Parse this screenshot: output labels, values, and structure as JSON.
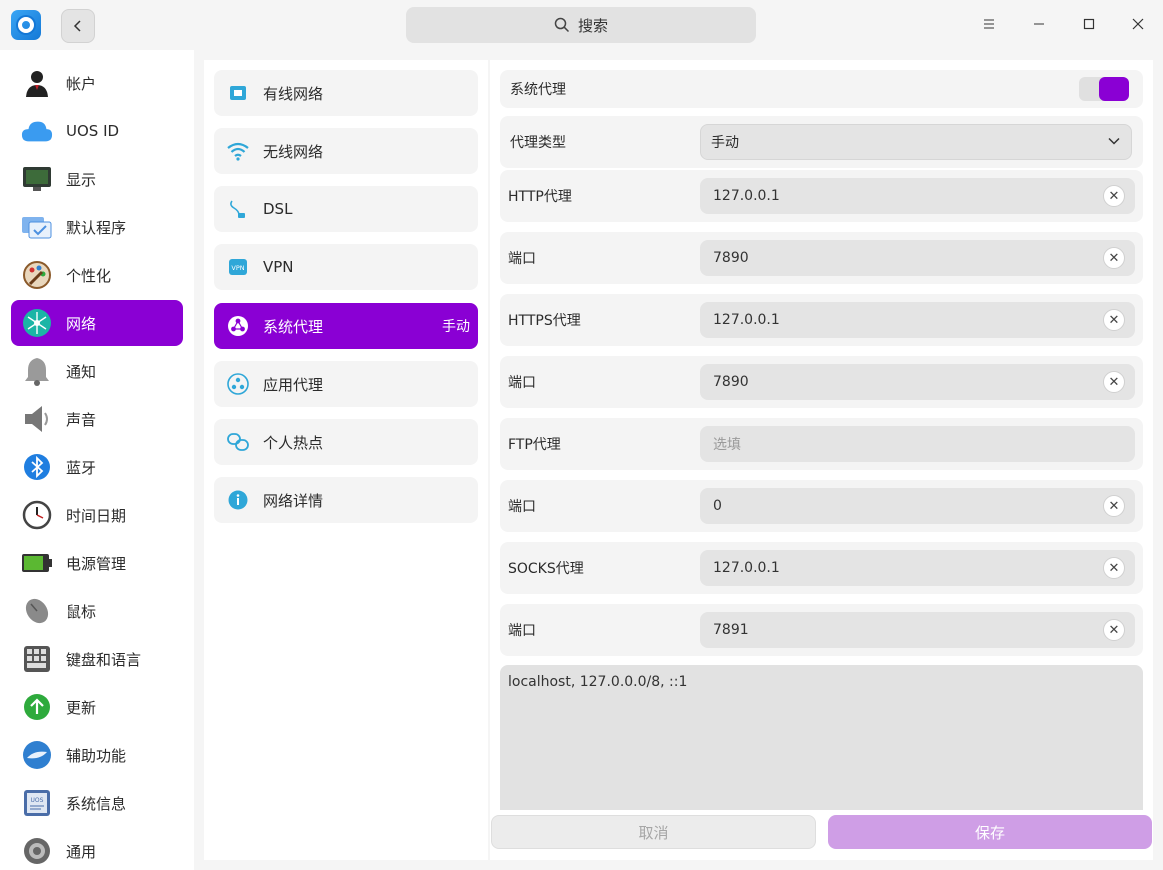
{
  "search": {
    "label": "搜索",
    "icon": "search-icon"
  },
  "sidebar": {
    "items": [
      {
        "label": "帐户",
        "icon": "user-account-icon",
        "color": "#333333"
      },
      {
        "label": "UOS ID",
        "icon": "cloud-icon",
        "color": "#3a9bf0"
      },
      {
        "label": "显示",
        "icon": "monitor-icon",
        "color": "#2f3a33"
      },
      {
        "label": "默认程序",
        "icon": "default-apps-icon",
        "color": "#4c90e0"
      },
      {
        "label": "个性化",
        "icon": "palette-icon",
        "color": "#8b5a2b"
      },
      {
        "label": "网络",
        "icon": "network-icon",
        "color": "#1bb5a6"
      },
      {
        "label": "通知",
        "icon": "bell-icon",
        "color": "#888888"
      },
      {
        "label": "声音",
        "icon": "speaker-icon",
        "color": "#777777"
      },
      {
        "label": "蓝牙",
        "icon": "bluetooth-icon",
        "color": "#1f7ee0"
      },
      {
        "label": "时间日期",
        "icon": "clock-icon",
        "color": "#444444"
      },
      {
        "label": "电源管理",
        "icon": "battery-icon",
        "color": "#5bb832"
      },
      {
        "label": "鼠标",
        "icon": "mouse-icon",
        "color": "#666666"
      },
      {
        "label": "键盘和语言",
        "icon": "keyboard-icon",
        "color": "#555555"
      },
      {
        "label": "更新",
        "icon": "update-arrow-icon",
        "color": "#2eaa3c"
      },
      {
        "label": "辅助功能",
        "icon": "accessibility-icon",
        "color": "#2f7fd0"
      },
      {
        "label": "系统信息",
        "icon": "system-info-icon",
        "color": "#4a6da8"
      },
      {
        "label": "通用",
        "icon": "general-gear-icon",
        "color": "#555555"
      }
    ],
    "active_index": 5
  },
  "network_menu": {
    "items": [
      {
        "label": "有线网络",
        "icon": "wired-network-icon",
        "badge": ""
      },
      {
        "label": "无线网络",
        "icon": "wifi-icon",
        "badge": ""
      },
      {
        "label": "DSL",
        "icon": "dsl-icon",
        "badge": ""
      },
      {
        "label": "VPN",
        "icon": "vpn-icon",
        "badge": ""
      },
      {
        "label": "系统代理",
        "icon": "system-proxy-icon",
        "badge": "手动"
      },
      {
        "label": "应用代理",
        "icon": "app-proxy-icon",
        "badge": ""
      },
      {
        "label": "个人热点",
        "icon": "hotspot-icon",
        "badge": ""
      },
      {
        "label": "网络详情",
        "icon": "info-icon",
        "badge": ""
      }
    ],
    "active_index": 4,
    "accent": "#8a00d4"
  },
  "proxy": {
    "system_proxy_label": "系统代理",
    "system_proxy_enabled": true,
    "type_label": "代理类型",
    "type_value": "手动",
    "fields": [
      {
        "label": "HTTP代理",
        "value": "127.0.0.1",
        "placeholder": ""
      },
      {
        "label": "端口",
        "value": "7890",
        "placeholder": ""
      },
      {
        "label": "HTTPS代理",
        "value": "127.0.0.1",
        "placeholder": ""
      },
      {
        "label": "端口",
        "value": "7890",
        "placeholder": ""
      },
      {
        "label": "FTP代理",
        "value": "",
        "placeholder": "选填"
      },
      {
        "label": "端口",
        "value": "0",
        "placeholder": ""
      },
      {
        "label": "SOCKS代理",
        "value": "127.0.0.1",
        "placeholder": ""
      },
      {
        "label": "端口",
        "value": "7891",
        "placeholder": ""
      }
    ],
    "ignore_hosts": "localhost, 127.0.0.0/8, ::1"
  },
  "actions": {
    "cancel": "取消",
    "save": "保存"
  }
}
